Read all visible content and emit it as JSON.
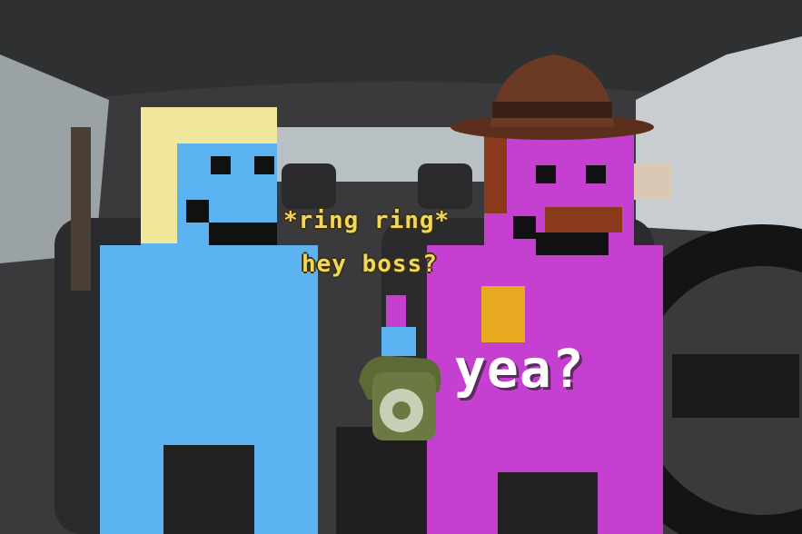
{
  "scene": {
    "caption_ring": "*ring ring*",
    "caption_boss": "hey boss?",
    "caption_yea": "yea?"
  },
  "colors": {
    "blue_character": "#5cb3f2",
    "blue_hair": "#f1e79b",
    "purple_character": "#c53fd0",
    "purple_badge": "#e6a91f",
    "hat": "#6b3a24",
    "phone": "#6a7a42",
    "caption_yellow": "#f0d860"
  },
  "icons": [
    "rotary-phone-icon",
    "fedora-hat-icon",
    "steering-wheel-icon"
  ]
}
